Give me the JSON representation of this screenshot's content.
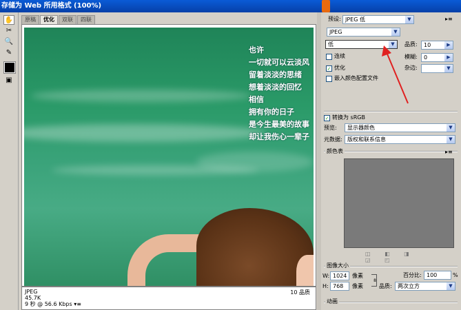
{
  "window": {
    "title": "存储为 Web 所用格式 (100%)"
  },
  "tools": [
    {
      "name": "hand-tool-icon",
      "glyph": "✋"
    },
    {
      "name": "slice-select-tool-icon",
      "glyph": "✂"
    },
    {
      "name": "zoom-tool-icon",
      "glyph": "🔍"
    },
    {
      "name": "eyedropper-tool-icon",
      "glyph": "✎"
    }
  ],
  "toolbar": {
    "preview_glyph": "▣"
  },
  "tabs": [
    "原稿",
    "优化",
    "双联",
    "四联"
  ],
  "image": {
    "poem_lines": [
      "也许",
      "一切就可以云淡风",
      "留着淡淡的思绪",
      "想着淡淡的回忆",
      "相信",
      "拥有你的日子",
      "是今生最美的故事",
      "却让我伤心一辈子"
    ]
  },
  "status_bar": {
    "format": "JPEG",
    "size": "45.7K",
    "time": "9 秒 @ 56.6 Kbps",
    "time_arrow": "▾≡",
    "quality": "10 品质"
  },
  "settings": {
    "preset_label": "预设:",
    "preset_value": "JPEG 低",
    "menu_glyph": "▸≡",
    "format_value": "JPEG",
    "compression_value": "低",
    "quality_label": "品质:",
    "quality_value": "10",
    "progressive_label": "连续",
    "progressive_checked": "",
    "blur_label": "模糊:",
    "blur_value": "0",
    "optimized_label": "优化",
    "optimized_checked": "✓",
    "matte_label": "杂边:",
    "matte_value": "",
    "icc_label": "嵌入颜色配置文件",
    "icc_checked": "",
    "srgb_label": "转换为 sRGB",
    "srgb_checked": "✓",
    "preview_label": "预览:",
    "preview_value": "显示器颜色",
    "metadata_label": "元数据:",
    "metadata_value": "版权和联系信息"
  },
  "color_table": {
    "title": "颜色表",
    "menu_glyph": "▸≡",
    "icons_glyphs": "◫ ◧ ◨ ◲ ◰"
  },
  "image_size": {
    "title": "图像大小",
    "w_label": "W:",
    "w_value": "1024",
    "h_label": "H:",
    "h_value": "768",
    "unit": "像素",
    "link_glyph": "8",
    "percent_label": "百分比:",
    "percent_value": "100",
    "percent_unit": "%",
    "quality_label": "品质:",
    "quality_value": "两次立方"
  },
  "animation": {
    "title": "动画"
  },
  "colors": {
    "title_bar": "#0a5bd6",
    "annotation_arrow": "#e02020"
  }
}
